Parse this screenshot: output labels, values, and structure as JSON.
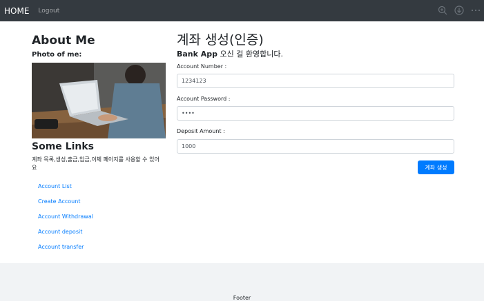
{
  "navbar": {
    "brand": "HOME",
    "logout": "Logout",
    "icons": [
      "zoom-icon",
      "download-icon",
      "more-icon"
    ]
  },
  "sidebar": {
    "about_title": "About Me",
    "photo_label": "Photo of me:",
    "links_title": "Some Links",
    "links_desc": "계좌 목록,생성,출금,입금,이체 페이지를 사용할 수 있어요",
    "links": [
      {
        "label": "Account List"
      },
      {
        "label": "Create Account"
      },
      {
        "label": "Account Withdrawal"
      },
      {
        "label": "Account deposit"
      },
      {
        "label": "Account transfer"
      }
    ]
  },
  "main": {
    "title": "계좌 생성(인증)",
    "welcome_bold": "Bank App",
    "welcome_rest": " 오신 걸 환영합니다.",
    "fields": {
      "account_number": {
        "label": "Account Number :",
        "value": "1234123"
      },
      "account_password": {
        "label": "Account Password :",
        "value": "••••"
      },
      "deposit_amount": {
        "label": "Deposit Amount :",
        "value": "1000"
      }
    },
    "submit_label": "계좌 생성"
  },
  "footer": {
    "text": "Footer"
  },
  "colors": {
    "navbar": "#343a40",
    "link": "#007bff",
    "primary": "#007bff",
    "footer_bg": "#f1f3f5"
  }
}
